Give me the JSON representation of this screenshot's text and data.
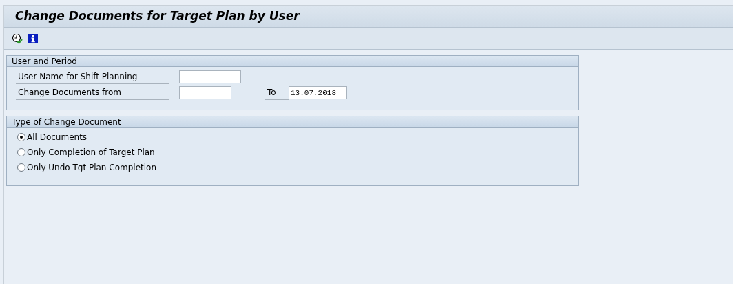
{
  "window": {
    "title": "Change Documents for Target Plan by User"
  },
  "toolbar": {
    "buttons": [
      {
        "kind": "execute"
      },
      {
        "kind": "info"
      }
    ]
  },
  "user_and_period": {
    "title": "User and Period",
    "fields": [
      {
        "label": "User Name for Shift Planning"
      },
      {
        "label": "Change Documents from",
        "to_label": "To",
        "to_value": "13.07.2018"
      }
    ]
  },
  "type_of_change_document": {
    "title": "Type of Change Document",
    "options": [
      {
        "label": "All Documents",
        "selected": true
      },
      {
        "label": "Only Completion of Target Plan",
        "selected": false
      },
      {
        "label": "Only Undo Tgt Plan Completion",
        "selected": false
      }
    ]
  }
}
